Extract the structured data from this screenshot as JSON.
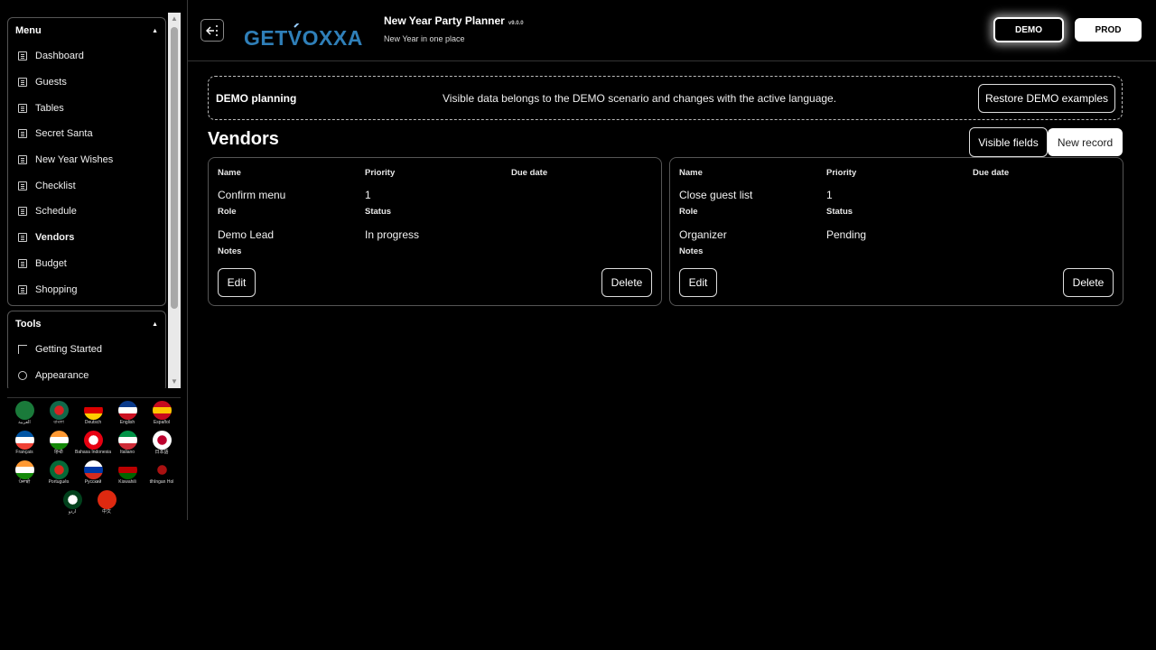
{
  "header": {
    "logo_text": "GETVOXXA",
    "app_title": "New Year Party Planner",
    "version": "v9.0.0",
    "subtitle": "New Year in one place",
    "env_demo": "DEMO",
    "env_prod": "PROD",
    "toggle_icon": "collapse-sidebar-icon"
  },
  "sidebar": {
    "menu_title": "Menu",
    "menu_items": [
      {
        "label": "Dashboard"
      },
      {
        "label": "Guests"
      },
      {
        "label": "Tables"
      },
      {
        "label": "Secret Santa"
      },
      {
        "label": "New Year Wishes"
      },
      {
        "label": "Checklist"
      },
      {
        "label": "Schedule"
      },
      {
        "label": "Vendors",
        "active": true
      },
      {
        "label": "Budget"
      },
      {
        "label": "Shopping"
      }
    ],
    "tools_title": "Tools",
    "tools_items": [
      {
        "label": "Getting Started"
      },
      {
        "label": "Appearance"
      }
    ],
    "languages": [
      {
        "name": "العربية",
        "colors": [
          "#1a7a3a",
          "#1a7a3a"
        ]
      },
      {
        "name": "বাংলা",
        "colors": [
          "#11694a",
          "#d82222"
        ]
      },
      {
        "name": "Deutsch",
        "colors": [
          "#000000",
          "#dd0000",
          "#ffce00"
        ]
      },
      {
        "name": "English",
        "colors": [
          "#0a3a8a",
          "#ffffff",
          "#cc1122"
        ]
      },
      {
        "name": "Español",
        "colors": [
          "#c60b1e",
          "#ffc400",
          "#c60b1e"
        ]
      },
      {
        "name": "Français",
        "colors": [
          "#0055a4",
          "#ffffff",
          "#ef4135"
        ]
      },
      {
        "name": "हिन्दी",
        "colors": [
          "#ff9933",
          "#ffffff",
          "#138808"
        ]
      },
      {
        "name": "Bahasa Indonesia",
        "colors": [
          "#e70011",
          "#ffffff"
        ]
      },
      {
        "name": "Italiano",
        "colors": [
          "#009246",
          "#ffffff",
          "#ce2b37"
        ]
      },
      {
        "name": "日本語",
        "colors": [
          "#ffffff",
          "#bc002d"
        ]
      },
      {
        "name": "ਪੰਜਾਬੀ",
        "colors": [
          "#ff9933",
          "#ffffff",
          "#138808"
        ]
      },
      {
        "name": "Português",
        "colors": [
          "#046a38",
          "#da291c"
        ]
      },
      {
        "name": "Русский",
        "colors": [
          "#ffffff",
          "#0039a6",
          "#d52b1e"
        ]
      },
      {
        "name": "Kiswahili",
        "colors": [
          "#000000",
          "#bb0000",
          "#006600"
        ]
      },
      {
        "name": "tlhIngan Hol",
        "colors": [
          "#000000",
          "#aa1111"
        ]
      },
      {
        "name": "اردو",
        "colors": [
          "#01411c",
          "#ffffff"
        ]
      },
      {
        "name": "中文",
        "colors": [
          "#de2910",
          "#de2910"
        ]
      }
    ]
  },
  "banner": {
    "title": "DEMO planning",
    "text": "Visible data belongs to the DEMO scenario and changes with the active language.",
    "restore_label": "Restore DEMO examples"
  },
  "main": {
    "section_title": "Vendors",
    "visible_fields_label": "Visible fields",
    "new_record_label": "New record",
    "field_labels": {
      "name": "Name",
      "priority": "Priority",
      "due_date": "Due date",
      "role": "Role",
      "status": "Status",
      "notes": "Notes"
    },
    "edit_label": "Edit",
    "delete_label": "Delete",
    "records": [
      {
        "name": "Confirm menu",
        "priority": "1",
        "due_date": "",
        "role": "Demo Lead",
        "status": "In progress",
        "notes": ""
      },
      {
        "name": "Close guest list",
        "priority": "1",
        "due_date": "",
        "role": "Organizer",
        "status": "Pending",
        "notes": ""
      }
    ]
  },
  "colors": {
    "background": "#000000",
    "accent_logo": "#2f7fb8",
    "border": "#555555"
  }
}
